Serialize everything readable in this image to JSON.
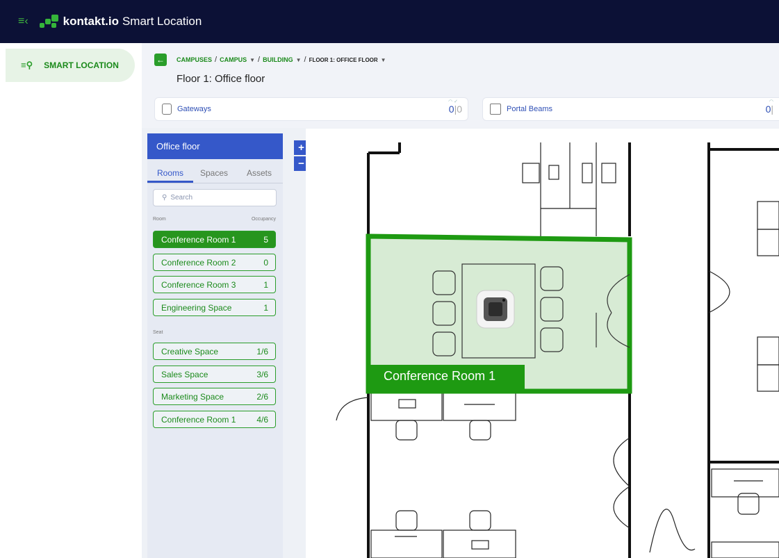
{
  "app": {
    "brand": "kontakt.io",
    "product": "Smart Location"
  },
  "nav": {
    "item_label": "SMART LOCATION"
  },
  "breadcrumb": {
    "campuses": "CAMPUSES",
    "campus": "CAMPUS",
    "building": "BUILDING",
    "floor": "FLOOR 1: OFFICE FLOOR",
    "separator": "/"
  },
  "page": {
    "title": "Floor 1: Office floor"
  },
  "cards": {
    "gateways": {
      "label": "Gateways",
      "online": "0",
      "offline": "0"
    },
    "portal_beams": {
      "label": "Portal Beams",
      "online": "0"
    }
  },
  "panel": {
    "title": "Office floor",
    "tabs": [
      "Rooms",
      "Spaces",
      "Assets"
    ],
    "search_placeholder": "Search",
    "col_room": "Room",
    "col_occupancy": "Occupancy",
    "rooms": [
      {
        "name": "Conference Room 1",
        "value": "5"
      },
      {
        "name": "Conference Room 2",
        "value": "0"
      },
      {
        "name": "Conference Room 3",
        "value": "1"
      },
      {
        "name": "Engineering Space",
        "value": "1"
      }
    ],
    "seat_label": "Seat",
    "seats": [
      {
        "name": "Creative Space",
        "value": "1/6"
      },
      {
        "name": "Sales Space",
        "value": "3/6"
      },
      {
        "name": "Marketing Space",
        "value": "2/6"
      },
      {
        "name": "Conference Room 1",
        "value": "4/6"
      }
    ]
  },
  "zoom": {
    "in": "+",
    "out": "−"
  },
  "map": {
    "highlighted_room": "Conference Room 1"
  },
  "colors": {
    "nav_bg": "#0c1136",
    "accent_green": "#2a9d2a",
    "accent_blue": "#3558c9"
  }
}
